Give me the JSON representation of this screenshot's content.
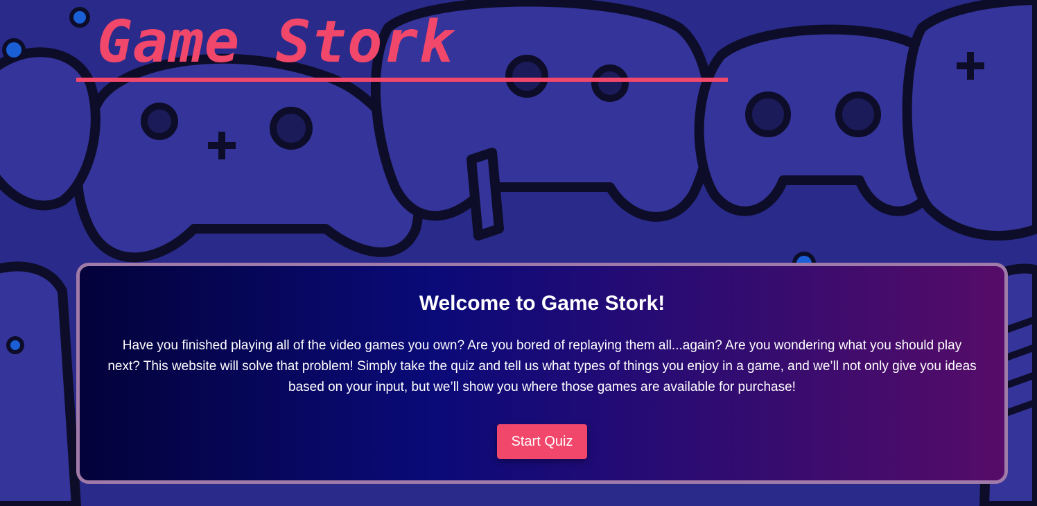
{
  "header": {
    "site_title": "Game Stork"
  },
  "welcome_card": {
    "heading": "Welcome to Game Stork!",
    "description": "Have you finished playing all of the video games you own? Are you bored of replaying them all...again? Are you wondering what you should play next? This website will solve that problem! Simply take the quiz and tell us what types of things you enjoy in a game, and we’ll not only give you ideas based on your input, but we’ll show you where those games are available for purchase!",
    "start_button_label": "Start Quiz"
  },
  "colors": {
    "accent": "#f0476b",
    "background": "#2a2a8a",
    "card_border": "#a07aa8",
    "text": "#ffffff"
  },
  "icons": {
    "background": "game-controller-pattern"
  }
}
